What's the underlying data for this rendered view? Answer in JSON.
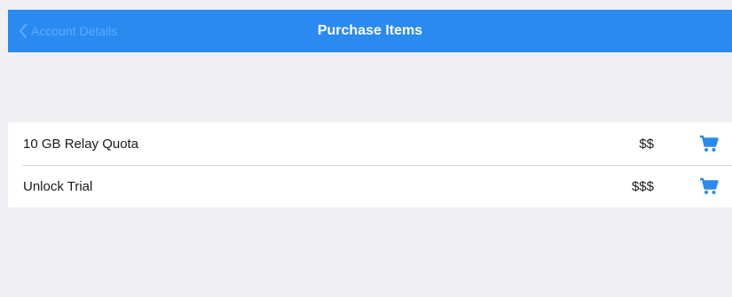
{
  "navbar": {
    "back_label": "Account Details",
    "title": "Purchase Items"
  },
  "items": [
    {
      "label": "10 GB Relay Quota",
      "price": "$$",
      "icon": "cart-icon"
    },
    {
      "label": "Unlock Trial",
      "price": "$$$",
      "icon": "cart-icon"
    }
  ],
  "colors": {
    "accent": "#2a8af0",
    "background": "#efeff4",
    "cell": "#ffffff"
  }
}
